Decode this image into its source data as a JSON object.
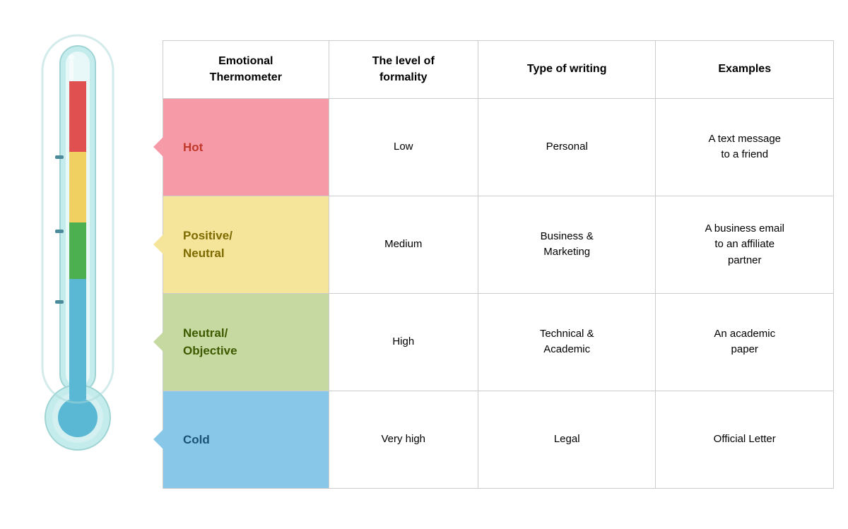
{
  "thermometer": {
    "label": "Thermometer"
  },
  "table": {
    "headers": {
      "emotion": "Emotional\nThermometer",
      "formality": "The level of\nformality",
      "type": "Type of writing",
      "examples": "Examples"
    },
    "rows": [
      {
        "id": "hot",
        "emotion": "Hot",
        "formality": "Low",
        "type": "Personal",
        "example": "A text message\nto a friend"
      },
      {
        "id": "pos",
        "emotion": "Positive/\nNeutral",
        "formality": "Medium",
        "type": "Business &\nMarketing",
        "example": "A business email\nto an affiliate\npartner"
      },
      {
        "id": "neu",
        "emotion": "Neutral/\nObjective",
        "formality": "High",
        "type": "Technical &\nAcademic",
        "example": "An academic\npaper"
      },
      {
        "id": "cold",
        "emotion": "Cold",
        "formality": "Very high",
        "type": "Legal",
        "example": "Official Letter"
      }
    ]
  }
}
